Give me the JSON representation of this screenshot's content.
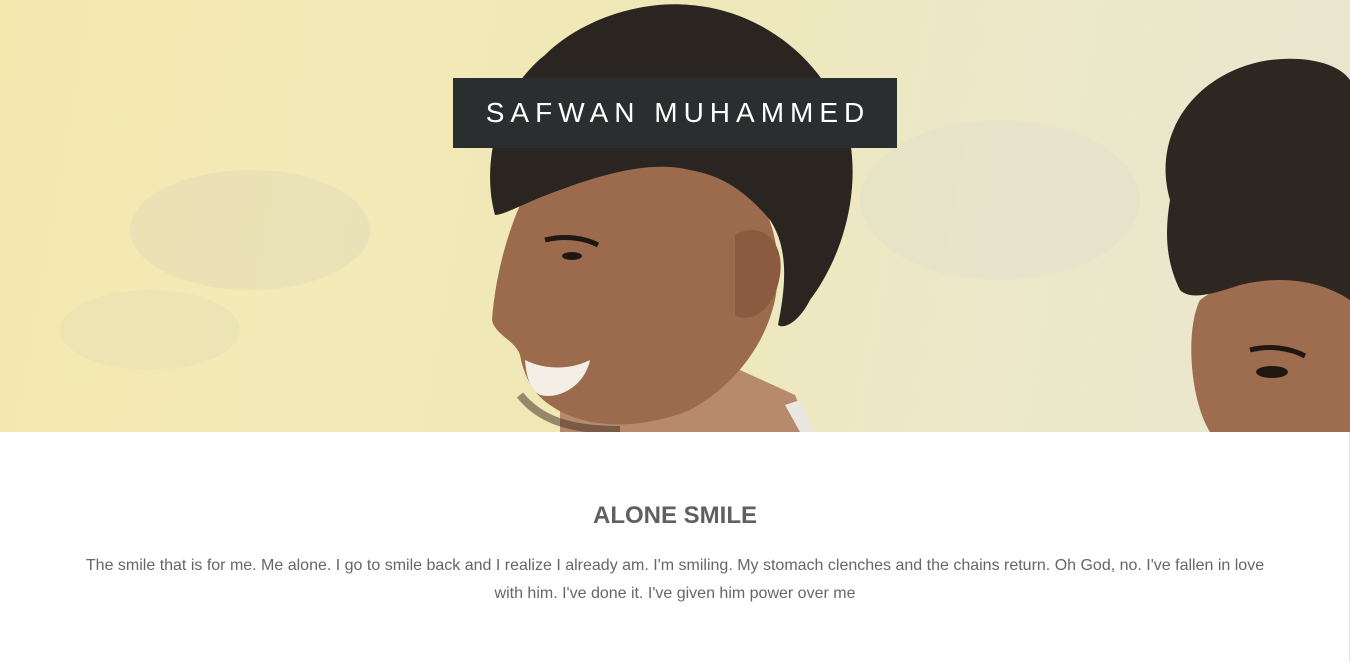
{
  "hero": {
    "name": "SAFWAN MUHAMMED"
  },
  "section": {
    "title": "ALONE SMILE",
    "body": "The smile that is for me. Me alone. I go to smile back and I realize I already am. I'm smiling. My stomach clenches and the chains return. Oh God, no. I've fallen in love with him. I've done it. I've given him power over me"
  }
}
